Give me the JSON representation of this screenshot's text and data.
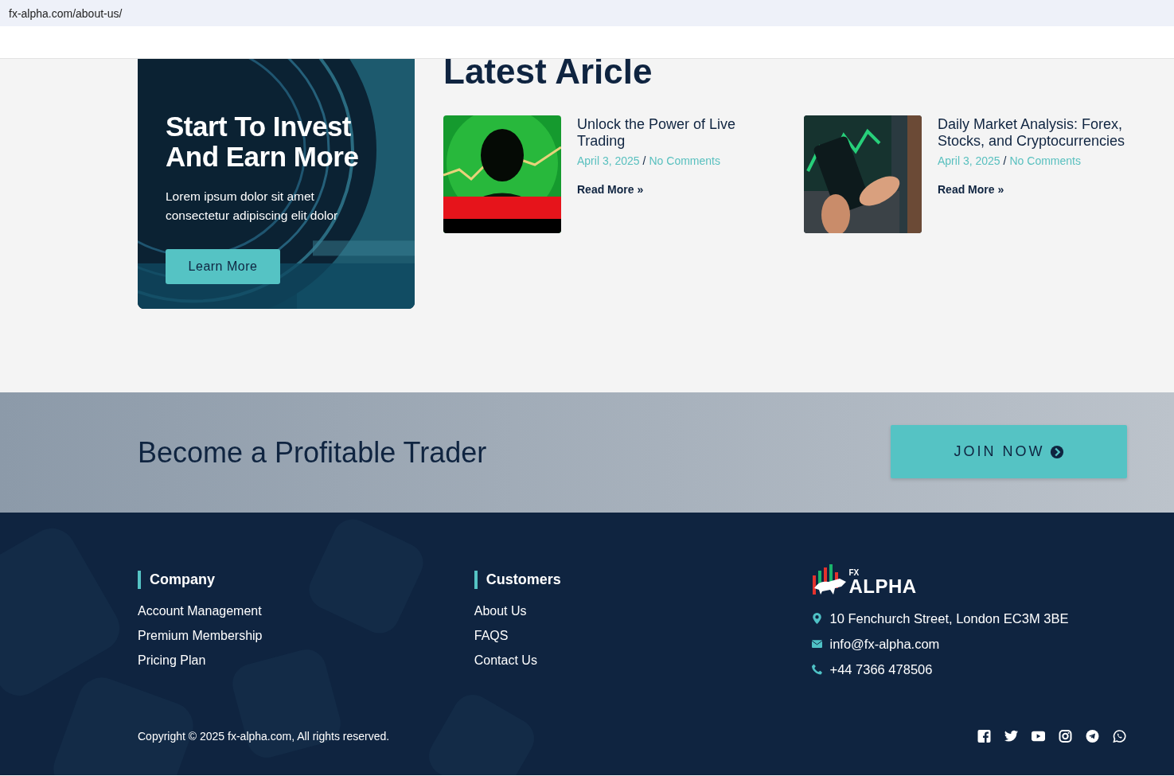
{
  "address_bar": {
    "url": "fx-alpha.com/about-us/"
  },
  "promo_card": {
    "kind": "picture",
    "title": "Start To Invest And Earn More",
    "text": "Lorem ipsum dolor sit amet consectetur adipiscing elit dolor",
    "button": "Learn More"
  },
  "latest": {
    "heading": "Latest Aricle",
    "articles": [
      {
        "kind": "live",
        "title": "Unlock the Power of Live Trading",
        "date": "April 3, 2025",
        "separator": "/",
        "comments": "No Comments",
        "read_more": "Read More »"
      },
      {
        "kind": "phone",
        "title": "Daily Market Analysis: Forex, Stocks, and Cryptocurrencies",
        "date": "April 3, 2025",
        "separator": "/",
        "comments": "No Comments",
        "read_more": "Read More »"
      }
    ]
  },
  "cta": {
    "heading": "Become a Profitable Trader",
    "button": "JOIN NOW"
  },
  "footer": {
    "columns": [
      {
        "heading": "Company",
        "links": [
          "Account Management",
          "Premium Membership",
          "Pricing Plan"
        ]
      },
      {
        "heading": "Customers",
        "links": [
          "About Us",
          "FAQS",
          "Contact Us"
        ]
      }
    ],
    "logo": {
      "prefix": "FX",
      "name": "ALPHA"
    },
    "contacts": [
      {
        "kind": "address",
        "text": "10 Fenchurch Street, London EC3M 3BE"
      },
      {
        "kind": "email",
        "text": "info@fx-alpha.com"
      },
      {
        "kind": "phone",
        "text": "+44 7366 478506"
      }
    ],
    "copyright": "Copyright © 2025 fx-alpha.com, All rights reserved.",
    "social": [
      {
        "kind": "facebook"
      },
      {
        "kind": "twitter"
      },
      {
        "kind": "youtube"
      },
      {
        "kind": "instagram"
      },
      {
        "kind": "telegram"
      },
      {
        "kind": "whatsapp"
      }
    ]
  }
}
